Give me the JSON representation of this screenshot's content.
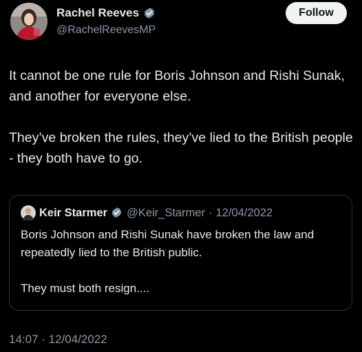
{
  "author": {
    "display_name": "Rachel Reeves",
    "handle": "@RachelReevesMP",
    "verified": true,
    "avatar_icon": "profile-photo"
  },
  "actions": {
    "follow_label": "Follow"
  },
  "tweet": {
    "paragraph_1": "It cannot be one rule for Boris Johnson and Rishi Sunak, and another for everyone else.",
    "paragraph_2": "They’ve broken the rules, they’ve lied to the British people - they both have to go."
  },
  "quoted_tweet": {
    "display_name": "Keir Starmer",
    "handle": "@Keir_Starmer",
    "separator": "·",
    "date": "12/04/2022",
    "verified": true,
    "paragraph_1": "Boris Johnson and Rishi Sunak have broken the law and repeatedly lied to the British public.",
    "paragraph_2": "They must both resign...."
  },
  "meta": {
    "timestamp": "14:07 · 12/04/2022"
  },
  "colors": {
    "background": "#000000",
    "text_primary": "#e7e9ea",
    "text_secondary": "#8b98a5",
    "verified_badge": "#829aab",
    "follow_bg": "#eff3f4",
    "border": "#2f3336"
  }
}
